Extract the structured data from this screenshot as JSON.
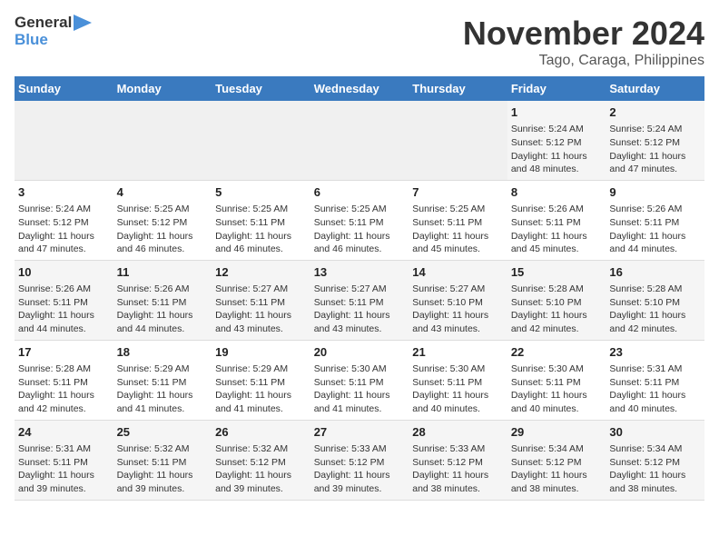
{
  "logo": {
    "general": "General",
    "blue": "Blue"
  },
  "title": "November 2024",
  "subtitle": "Tago, Caraga, Philippines",
  "days_of_week": [
    "Sunday",
    "Monday",
    "Tuesday",
    "Wednesday",
    "Thursday",
    "Friday",
    "Saturday"
  ],
  "weeks": [
    [
      {
        "day": "",
        "info": ""
      },
      {
        "day": "",
        "info": ""
      },
      {
        "day": "",
        "info": ""
      },
      {
        "day": "",
        "info": ""
      },
      {
        "day": "",
        "info": ""
      },
      {
        "day": "1",
        "info": "Sunrise: 5:24 AM\nSunset: 5:12 PM\nDaylight: 11 hours and 48 minutes."
      },
      {
        "day": "2",
        "info": "Sunrise: 5:24 AM\nSunset: 5:12 PM\nDaylight: 11 hours and 47 minutes."
      }
    ],
    [
      {
        "day": "3",
        "info": "Sunrise: 5:24 AM\nSunset: 5:12 PM\nDaylight: 11 hours and 47 minutes."
      },
      {
        "day": "4",
        "info": "Sunrise: 5:25 AM\nSunset: 5:12 PM\nDaylight: 11 hours and 46 minutes."
      },
      {
        "day": "5",
        "info": "Sunrise: 5:25 AM\nSunset: 5:11 PM\nDaylight: 11 hours and 46 minutes."
      },
      {
        "day": "6",
        "info": "Sunrise: 5:25 AM\nSunset: 5:11 PM\nDaylight: 11 hours and 46 minutes."
      },
      {
        "day": "7",
        "info": "Sunrise: 5:25 AM\nSunset: 5:11 PM\nDaylight: 11 hours and 45 minutes."
      },
      {
        "day": "8",
        "info": "Sunrise: 5:26 AM\nSunset: 5:11 PM\nDaylight: 11 hours and 45 minutes."
      },
      {
        "day": "9",
        "info": "Sunrise: 5:26 AM\nSunset: 5:11 PM\nDaylight: 11 hours and 44 minutes."
      }
    ],
    [
      {
        "day": "10",
        "info": "Sunrise: 5:26 AM\nSunset: 5:11 PM\nDaylight: 11 hours and 44 minutes."
      },
      {
        "day": "11",
        "info": "Sunrise: 5:26 AM\nSunset: 5:11 PM\nDaylight: 11 hours and 44 minutes."
      },
      {
        "day": "12",
        "info": "Sunrise: 5:27 AM\nSunset: 5:11 PM\nDaylight: 11 hours and 43 minutes."
      },
      {
        "day": "13",
        "info": "Sunrise: 5:27 AM\nSunset: 5:11 PM\nDaylight: 11 hours and 43 minutes."
      },
      {
        "day": "14",
        "info": "Sunrise: 5:27 AM\nSunset: 5:10 PM\nDaylight: 11 hours and 43 minutes."
      },
      {
        "day": "15",
        "info": "Sunrise: 5:28 AM\nSunset: 5:10 PM\nDaylight: 11 hours and 42 minutes."
      },
      {
        "day": "16",
        "info": "Sunrise: 5:28 AM\nSunset: 5:10 PM\nDaylight: 11 hours and 42 minutes."
      }
    ],
    [
      {
        "day": "17",
        "info": "Sunrise: 5:28 AM\nSunset: 5:11 PM\nDaylight: 11 hours and 42 minutes."
      },
      {
        "day": "18",
        "info": "Sunrise: 5:29 AM\nSunset: 5:11 PM\nDaylight: 11 hours and 41 minutes."
      },
      {
        "day": "19",
        "info": "Sunrise: 5:29 AM\nSunset: 5:11 PM\nDaylight: 11 hours and 41 minutes."
      },
      {
        "day": "20",
        "info": "Sunrise: 5:30 AM\nSunset: 5:11 PM\nDaylight: 11 hours and 41 minutes."
      },
      {
        "day": "21",
        "info": "Sunrise: 5:30 AM\nSunset: 5:11 PM\nDaylight: 11 hours and 40 minutes."
      },
      {
        "day": "22",
        "info": "Sunrise: 5:30 AM\nSunset: 5:11 PM\nDaylight: 11 hours and 40 minutes."
      },
      {
        "day": "23",
        "info": "Sunrise: 5:31 AM\nSunset: 5:11 PM\nDaylight: 11 hours and 40 minutes."
      }
    ],
    [
      {
        "day": "24",
        "info": "Sunrise: 5:31 AM\nSunset: 5:11 PM\nDaylight: 11 hours and 39 minutes."
      },
      {
        "day": "25",
        "info": "Sunrise: 5:32 AM\nSunset: 5:11 PM\nDaylight: 11 hours and 39 minutes."
      },
      {
        "day": "26",
        "info": "Sunrise: 5:32 AM\nSunset: 5:12 PM\nDaylight: 11 hours and 39 minutes."
      },
      {
        "day": "27",
        "info": "Sunrise: 5:33 AM\nSunset: 5:12 PM\nDaylight: 11 hours and 39 minutes."
      },
      {
        "day": "28",
        "info": "Sunrise: 5:33 AM\nSunset: 5:12 PM\nDaylight: 11 hours and 38 minutes."
      },
      {
        "day": "29",
        "info": "Sunrise: 5:34 AM\nSunset: 5:12 PM\nDaylight: 11 hours and 38 minutes."
      },
      {
        "day": "30",
        "info": "Sunrise: 5:34 AM\nSunset: 5:12 PM\nDaylight: 11 hours and 38 minutes."
      }
    ]
  ]
}
